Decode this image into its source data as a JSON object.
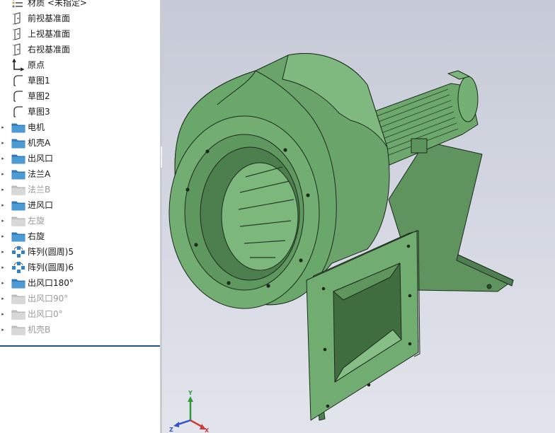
{
  "tree": {
    "items": [
      {
        "label": "材质 <未指定>",
        "icon": "material-icon",
        "state": "normal"
      },
      {
        "label": "前视基准面",
        "icon": "plane-icon",
        "state": "normal"
      },
      {
        "label": "上视基准面",
        "icon": "plane-icon",
        "state": "normal"
      },
      {
        "label": "右视基准面",
        "icon": "plane-icon",
        "state": "normal"
      },
      {
        "label": "原点",
        "icon": "origin-icon",
        "state": "normal"
      },
      {
        "label": "草图1",
        "icon": "sketch-icon",
        "state": "normal"
      },
      {
        "label": "草图2",
        "icon": "sketch-icon",
        "state": "normal"
      },
      {
        "label": "草图3",
        "icon": "sketch-icon",
        "state": "normal"
      },
      {
        "label": "电机",
        "icon": "folder-icon",
        "state": "normal"
      },
      {
        "label": "机壳A",
        "icon": "folder-icon",
        "state": "normal"
      },
      {
        "label": "出风口",
        "icon": "folder-icon",
        "state": "normal"
      },
      {
        "label": "法兰A",
        "icon": "folder-icon",
        "state": "normal"
      },
      {
        "label": "法兰B",
        "icon": "folder-icon",
        "state": "suppressed"
      },
      {
        "label": "进风口",
        "icon": "folder-icon",
        "state": "normal"
      },
      {
        "label": "左旋",
        "icon": "folder-icon",
        "state": "suppressed"
      },
      {
        "label": "右旋",
        "icon": "folder-icon",
        "state": "normal"
      },
      {
        "label": "阵列(圆周)5",
        "icon": "circular-pattern-icon",
        "state": "normal"
      },
      {
        "label": "阵列(圆周)6",
        "icon": "circular-pattern-icon",
        "state": "normal"
      },
      {
        "label": "出风口180°",
        "icon": "folder-icon",
        "state": "normal"
      },
      {
        "label": "出风口90°",
        "icon": "folder-icon",
        "state": "suppressed"
      },
      {
        "label": "出风口0°",
        "icon": "folder-icon",
        "state": "suppressed"
      },
      {
        "label": "机壳B",
        "icon": "folder-icon",
        "state": "suppressed"
      }
    ]
  },
  "triad": {
    "x_label": "X",
    "y_label": "Y",
    "z_label": "Z"
  },
  "colors": {
    "model_green": "#68a068",
    "model_green_light": "#82bb82",
    "model_green_dark": "#4c7d4d",
    "viewport_bg": "#cfd3dd",
    "folder_blue": "#2f82c4",
    "rollback_bar": "#27527f",
    "suppressed_text": "#9a9a9a"
  }
}
